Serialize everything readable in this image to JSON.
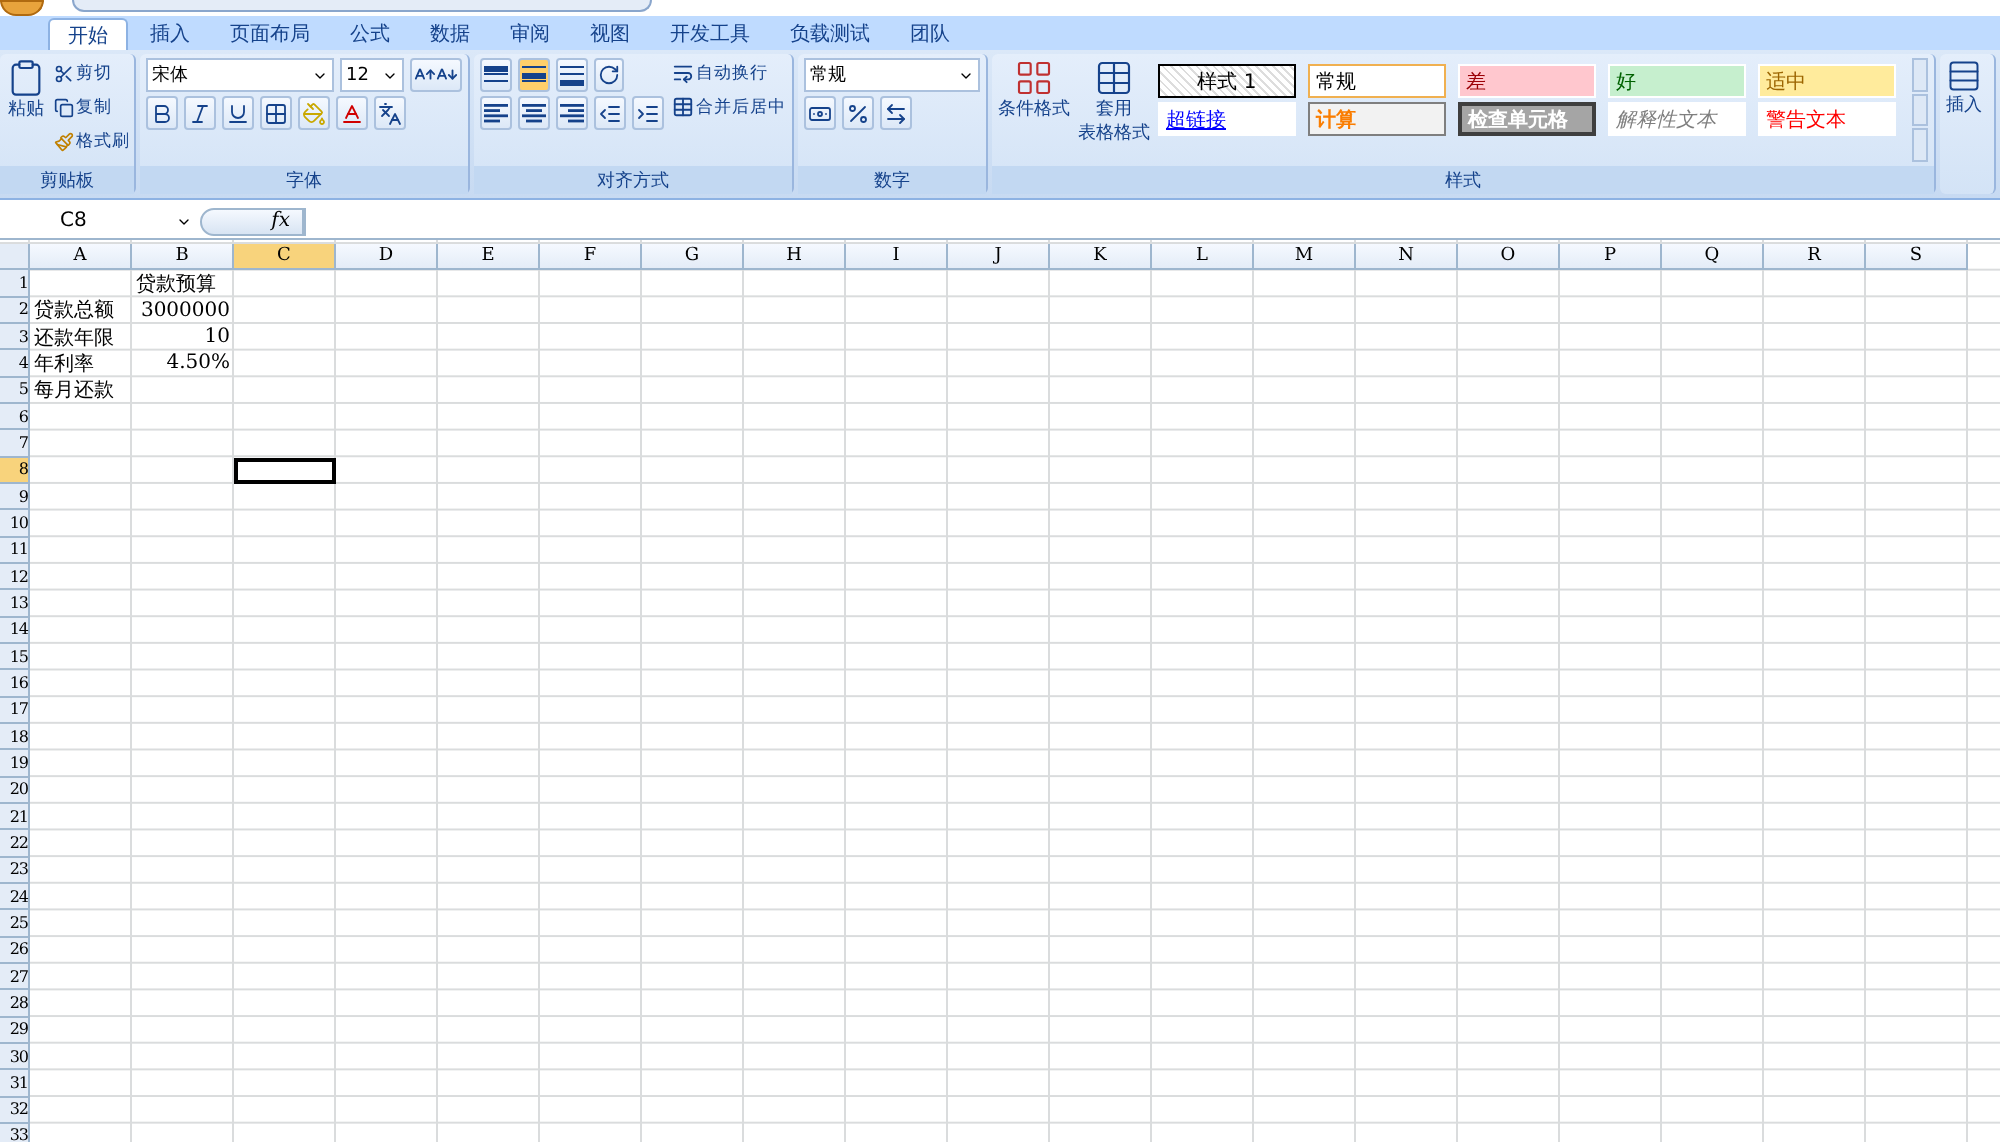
{
  "tabs": [
    {
      "label": "开始",
      "selected": true
    },
    {
      "label": "插入",
      "selected": false
    },
    {
      "label": "页面布局",
      "selected": false
    },
    {
      "label": "公式",
      "selected": false
    },
    {
      "label": "数据",
      "selected": false
    },
    {
      "label": "审阅",
      "selected": false
    },
    {
      "label": "视图",
      "selected": false
    },
    {
      "label": "开发工具",
      "selected": false
    },
    {
      "label": "负载测试",
      "selected": false
    },
    {
      "label": "团队",
      "selected": false
    }
  ],
  "clipboard": {
    "paste": "粘贴",
    "cut": "剪切",
    "copy": "复制",
    "format_painter": "格式刷",
    "group": "剪贴板"
  },
  "font": {
    "name": "宋体",
    "size": "12",
    "group": "字体"
  },
  "alignment": {
    "vertical": [
      {
        "selected": false
      },
      {
        "selected": true
      },
      {
        "selected": false
      }
    ],
    "wrap": "自动换行",
    "merge": "合并后居中",
    "group": "对齐方式"
  },
  "number": {
    "format": "常规",
    "group": "数字"
  },
  "styles": {
    "conditional": "条件格式",
    "table_format_1": "套用",
    "table_format_2": "表格格式",
    "group": "样式",
    "gallery": [
      {
        "label": "样式 1",
        "kind": "hatched"
      },
      {
        "label": "常规",
        "kind": "normal"
      },
      {
        "label": "差",
        "kind": "bad"
      },
      {
        "label": "好",
        "kind": "good"
      },
      {
        "label": "适中",
        "kind": "neutral"
      },
      {
        "label": "超链接",
        "kind": "link"
      },
      {
        "label": "计算",
        "kind": "calc"
      },
      {
        "label": "检查单元格",
        "kind": "check"
      },
      {
        "label": "解释性文本",
        "kind": "explain"
      },
      {
        "label": "警告文本",
        "kind": "warn"
      }
    ]
  },
  "cells_group": {
    "insert": "插入"
  },
  "formula_bar": {
    "name_box": "C8",
    "fx": "fx"
  },
  "sheet": {
    "columns": [
      {
        "label": "A",
        "selected": false
      },
      {
        "label": "B",
        "selected": false
      },
      {
        "label": "C",
        "selected": true
      },
      {
        "label": "D",
        "selected": false
      },
      {
        "label": "E",
        "selected": false
      },
      {
        "label": "F",
        "selected": false
      },
      {
        "label": "G",
        "selected": false
      },
      {
        "label": "H",
        "selected": false
      },
      {
        "label": "I",
        "selected": false
      },
      {
        "label": "J",
        "selected": false
      },
      {
        "label": "K",
        "selected": false
      },
      {
        "label": "L",
        "selected": false
      },
      {
        "label": "M",
        "selected": false
      },
      {
        "label": "N",
        "selected": false
      },
      {
        "label": "O",
        "selected": false
      },
      {
        "label": "P",
        "selected": false
      },
      {
        "label": "Q",
        "selected": false
      },
      {
        "label": "R",
        "selected": false
      },
      {
        "label": "S",
        "selected": false
      }
    ],
    "rows": [
      {
        "header": "1",
        "selected": false,
        "cells": [
          {
            "text": "",
            "kind": "text"
          },
          {
            "text": "贷款预算",
            "kind": "text"
          }
        ]
      },
      {
        "header": "2",
        "selected": false,
        "cells": [
          {
            "text": "贷款总额",
            "kind": "text"
          },
          {
            "text": "3000000",
            "kind": "number"
          }
        ]
      },
      {
        "header": "3",
        "selected": false,
        "cells": [
          {
            "text": "还款年限",
            "kind": "text"
          },
          {
            "text": "10",
            "kind": "number"
          }
        ]
      },
      {
        "header": "4",
        "selected": false,
        "cells": [
          {
            "text": "年利率",
            "kind": "text"
          },
          {
            "text": "4.50%",
            "kind": "number"
          }
        ]
      },
      {
        "header": "5",
        "selected": false,
        "cells": [
          {
            "text": "每月还款",
            "kind": "text"
          }
        ]
      },
      {
        "header": "6",
        "selected": false
      },
      {
        "header": "7",
        "selected": false
      },
      {
        "header": "8",
        "selected": true
      },
      {
        "header": "9",
        "selected": false
      },
      {
        "header": "10",
        "selected": false
      },
      {
        "header": "11",
        "selected": false
      },
      {
        "header": "12",
        "selected": false
      },
      {
        "header": "13",
        "selected": false
      },
      {
        "header": "14",
        "selected": false
      },
      {
        "header": "15",
        "selected": false
      },
      {
        "header": "16",
        "selected": false
      },
      {
        "header": "17",
        "selected": false
      },
      {
        "header": "18",
        "selected": false
      },
      {
        "header": "19",
        "selected": false
      },
      {
        "header": "20",
        "selected": false
      },
      {
        "header": "21",
        "selected": false
      },
      {
        "header": "22",
        "selected": false
      },
      {
        "header": "23",
        "selected": false
      },
      {
        "header": "24",
        "selected": false
      },
      {
        "header": "25",
        "selected": false
      },
      {
        "header": "26",
        "selected": false
      },
      {
        "header": "27",
        "selected": false
      },
      {
        "header": "28",
        "selected": false
      },
      {
        "header": "29",
        "selected": false
      },
      {
        "header": "30",
        "selected": false
      },
      {
        "header": "31",
        "selected": false
      },
      {
        "header": "32",
        "selected": false
      },
      {
        "header": "33",
        "selected": false
      }
    ]
  }
}
